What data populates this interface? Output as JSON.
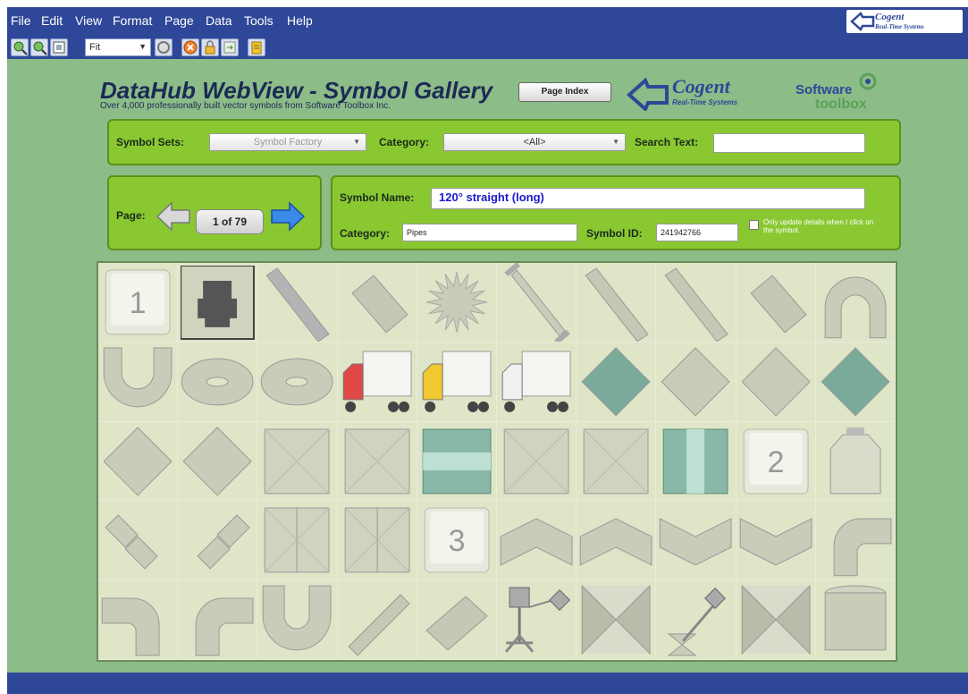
{
  "menu": [
    "File",
    "Edit",
    "View",
    "Format",
    "Page",
    "Data",
    "Tools",
    "Help"
  ],
  "top_logo": {
    "name": "Cogent",
    "sub": "Real-Time Systems"
  },
  "toolbar": {
    "zoom_value": "Fit"
  },
  "header": {
    "title": "DataHub WebView - Symbol Gallery",
    "subtitle": "Over 4,000 professionally built vector symbols from Software Toolbox Inc.",
    "page_index_label": "Page Index",
    "cogent_logo": {
      "name": "Cogent",
      "sub": "Real-Time Systems"
    },
    "st_logo": {
      "line1": "Software",
      "line2": "toolbox"
    }
  },
  "filters": {
    "symbol_sets_label": "Symbol Sets:",
    "symbol_sets_value": "Symbol Factory",
    "category_label": "Category:",
    "category_value": "<All>",
    "search_label": "Search Text:",
    "search_value": ""
  },
  "pager": {
    "label": "Page:",
    "value": "1 of 79"
  },
  "details": {
    "symbol_name_label": "Symbol Name:",
    "symbol_name_value": "120° straight (long)",
    "category_label": "Category:",
    "category_value": "Pipes",
    "symbol_id_label": "Symbol ID:",
    "symbol_id_value": "241942766",
    "only_update_label": "Only update details when I click on the symbol.",
    "only_update_checked": false
  },
  "gallery": {
    "symbols": [
      {
        "kind": "key",
        "text": "1"
      },
      {
        "kind": "jack"
      },
      {
        "kind": "pipe-diag",
        "color": "#b4b4b4"
      },
      {
        "kind": "pipe-fat"
      },
      {
        "kind": "star"
      },
      {
        "kind": "pipe-flange"
      },
      {
        "kind": "pipe-diag",
        "color": "#c4c8b4"
      },
      {
        "kind": "pipe-diag",
        "color": "#c4c8b4"
      },
      {
        "kind": "pipe-fat"
      },
      {
        "kind": "arch"
      },
      {
        "kind": "ubend"
      },
      {
        "kind": "donut"
      },
      {
        "kind": "donut"
      },
      {
        "kind": "truck",
        "color": "#e04848"
      },
      {
        "kind": "truck",
        "color": "#f0c830"
      },
      {
        "kind": "truck",
        "color": "#f0f0f0"
      },
      {
        "kind": "diamond",
        "color": "#7aab9a"
      },
      {
        "kind": "diamond",
        "color": "#c8ccb8"
      },
      {
        "kind": "diamond",
        "color": "#c8ccb8"
      },
      {
        "kind": "diamond",
        "color": "#7aab9a"
      },
      {
        "kind": "diamond",
        "color": "#c8ccb8"
      },
      {
        "kind": "diamond",
        "color": "#c8ccb8"
      },
      {
        "kind": "square"
      },
      {
        "kind": "square"
      },
      {
        "kind": "tank-teal"
      },
      {
        "kind": "square"
      },
      {
        "kind": "square"
      },
      {
        "kind": "tank-teal-v"
      },
      {
        "kind": "key",
        "text": "2"
      },
      {
        "kind": "vessel"
      },
      {
        "kind": "diamond-pair"
      },
      {
        "kind": "diamond-pair2"
      },
      {
        "kind": "square-split"
      },
      {
        "kind": "square-split"
      },
      {
        "kind": "key",
        "text": "3"
      },
      {
        "kind": "elbow-up"
      },
      {
        "kind": "elbow-up"
      },
      {
        "kind": "elbow-down"
      },
      {
        "kind": "elbow-down"
      },
      {
        "kind": "elbow-right"
      },
      {
        "kind": "elbow-left"
      },
      {
        "kind": "elbow-right"
      },
      {
        "kind": "elbow-u"
      },
      {
        "kind": "pipe-diag2"
      },
      {
        "kind": "pipe-fat2"
      },
      {
        "kind": "valve-actuator"
      },
      {
        "kind": "hourglass"
      },
      {
        "kind": "valve-small"
      },
      {
        "kind": "hourglass"
      },
      {
        "kind": "cylinder"
      }
    ]
  }
}
